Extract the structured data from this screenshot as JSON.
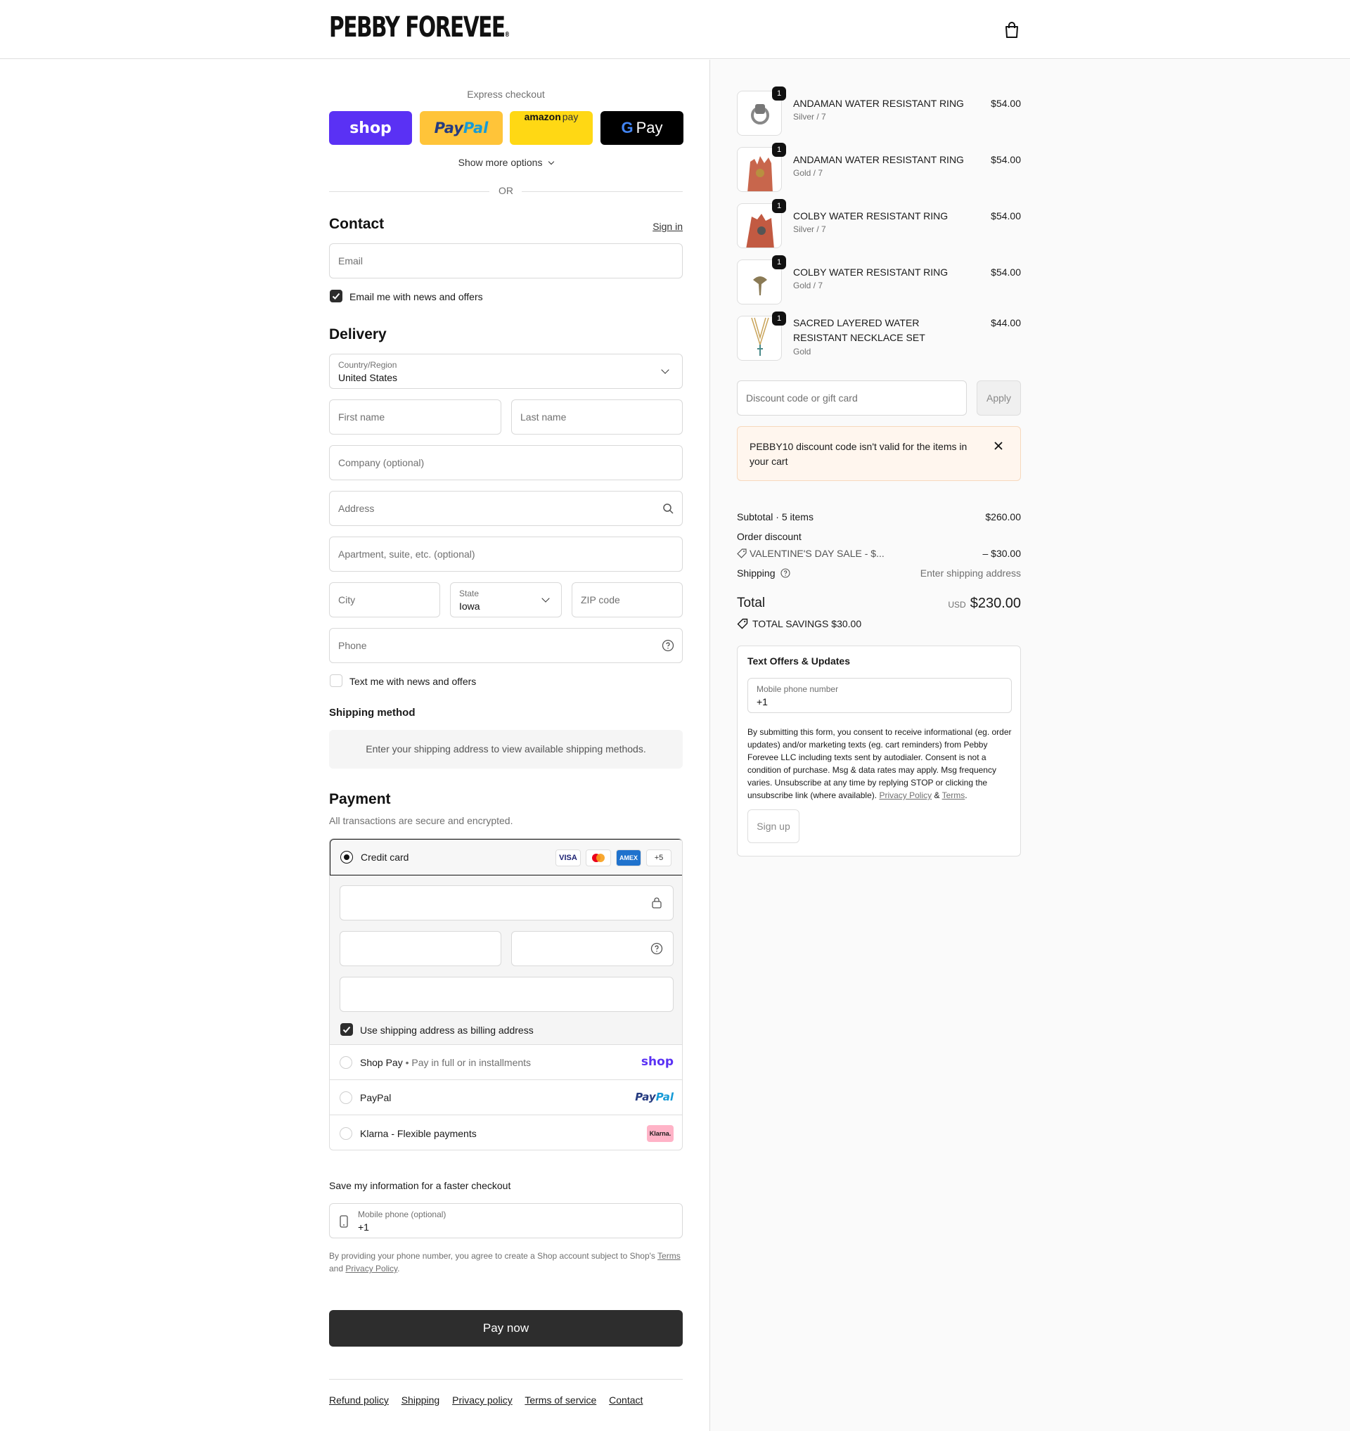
{
  "header": {
    "logo": "PEBBY FOREVEE",
    "logo_mark": "®"
  },
  "express": {
    "title": "Express checkout",
    "shop_label": "shop",
    "paypal_label_a": "Pay",
    "paypal_label_b": "Pal",
    "amazon_label_a": "amazon",
    "amazon_label_b": "pay",
    "gpay_label": "Pay",
    "more_options": "Show more options",
    "or": "OR"
  },
  "contact": {
    "title": "Contact",
    "sign_in": "Sign in",
    "email_placeholder": "Email",
    "email_offers": "Email me with news and offers"
  },
  "delivery": {
    "title": "Delivery",
    "country_label": "Country/Region",
    "country_value": "United States",
    "first_name": "First name",
    "last_name": "Last name",
    "company": "Company (optional)",
    "address": "Address",
    "apartment": "Apartment, suite, etc. (optional)",
    "city": "City",
    "state_label": "State",
    "state_value": "Iowa",
    "zip": "ZIP code",
    "phone": "Phone",
    "text_offers": "Text me with news and offers"
  },
  "shipping_method": {
    "title": "Shipping method",
    "message": "Enter your shipping address to view available shipping methods."
  },
  "payment": {
    "title": "Payment",
    "subtitle": "All transactions are secure and encrypted.",
    "credit_card": "Credit card",
    "visa": "VISA",
    "amex": "AMEX",
    "more_cards": "+5",
    "billing_same": "Use shipping address as billing address",
    "shop_pay": "Shop Pay",
    "shop_pay_note": "Pay in full or in installments",
    "shop_pay_logo": "shop",
    "paypal": "PayPal",
    "paypal_logo_a": "Pay",
    "paypal_logo_b": "Pal",
    "klarna": "Klarna - Flexible payments",
    "klarna_logo": "Klarna."
  },
  "save_info": {
    "title": "Save my information for a faster checkout",
    "phone_label": "Mobile phone (optional)",
    "phone_value": "+1",
    "note": "By providing your phone number, you agree to create a Shop account subject to Shop's",
    "terms": "Terms",
    "and": "and",
    "privacy": "Privacy Policy",
    "period": "."
  },
  "pay_now": "Pay now",
  "footer_links": [
    "Refund policy",
    "Shipping",
    "Privacy policy",
    "Terms of service",
    "Contact"
  ],
  "cart": {
    "items": [
      {
        "qty": "1",
        "name": "ANDAMAN WATER RESISTANT RING",
        "variant": "Silver / 7",
        "price": "$54.00"
      },
      {
        "qty": "1",
        "name": "ANDAMAN WATER RESISTANT RING",
        "variant": "Gold / 7",
        "price": "$54.00"
      },
      {
        "qty": "1",
        "name": "COLBY WATER RESISTANT RING",
        "variant": "Silver / 7",
        "price": "$54.00"
      },
      {
        "qty": "1",
        "name": "COLBY WATER RESISTANT RING",
        "variant": "Gold / 7",
        "price": "$54.00"
      },
      {
        "qty": "1",
        "name": "SACRED LAYERED WATER RESISTANT NECKLACE SET",
        "variant": "Gold",
        "price": "$44.00"
      }
    ],
    "discount_placeholder": "Discount code or gift card",
    "apply": "Apply",
    "alert": "PEBBY10 discount code isn't valid for the items in your cart",
    "subtotal_label": "Subtotal · 5 items",
    "subtotal_value": "$260.00",
    "order_discount_label": "Order discount",
    "discount_name": "VALENTINE'S DAY SALE - $...",
    "discount_value": "– $30.00",
    "shipping_label": "Shipping",
    "shipping_value": "Enter shipping address",
    "total_label": "Total",
    "currency": "USD",
    "total_value": "$230.00",
    "savings_label": "TOTAL SAVINGS",
    "savings_value": "$30.00"
  },
  "text_offers": {
    "title": "Text Offers & Updates",
    "phone_label": "Mobile phone number",
    "phone_value": "+1",
    "consent": "By submitting this form, you consent to receive informational (eg. order updates) and/or marketing texts (eg. cart reminders) from Pebby Forevee LLC including texts sent by autodialer. Consent is not a condition of purchase. Msg & data rates may apply. Msg frequency varies. Unsubscribe at any time by replying STOP or clicking the unsubscribe link (where available).",
    "privacy": "Privacy Policy",
    "amp": "&",
    "terms": "Terms",
    "period": ".",
    "signup": "Sign up"
  },
  "colors": {
    "shop_purple": "#5a31f4",
    "paypal_yellow": "#ffc439",
    "amazon_yellow": "#ffd814",
    "gpay_black": "#000000",
    "primary_button": "#2d2d2d",
    "alert_bg": "#fff6ee"
  }
}
